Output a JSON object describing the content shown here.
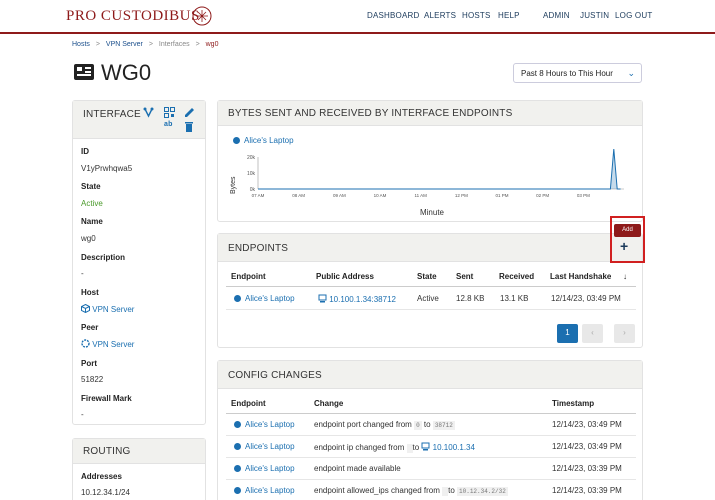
{
  "brand": "PRO CUSTODIBUS",
  "nav": [
    "DASHBOARD",
    "ALERTS",
    "HOSTS",
    "HELP",
    "ADMIN",
    "JUSTIN",
    "LOG OUT"
  ],
  "breadcrumb": [
    "Hosts",
    ">",
    "VPN Server",
    ">",
    "Interfaces",
    ">",
    "wg0"
  ],
  "page_title": "WG0",
  "time_range": "Past 8 Hours to This Hour",
  "interface_panel": {
    "title": "INTERFACE",
    "action_small": "ab",
    "fields": [
      {
        "label": "ID",
        "value": "V1yPrwhqwa5"
      },
      {
        "label": "State",
        "value": "Active"
      },
      {
        "label": "Name",
        "value": "wg0"
      },
      {
        "label": "Description",
        "value": "-"
      },
      {
        "label": "Host",
        "value": "VPN Server"
      },
      {
        "label": "Peer",
        "value": "VPN Server"
      },
      {
        "label": "Port",
        "value": "51822"
      },
      {
        "label": "Firewall Mark",
        "value": "-"
      }
    ]
  },
  "routing_panel": {
    "title": "ROUTING",
    "label": "Addresses",
    "value": "10.12.34.1/24"
  },
  "bytes_panel": {
    "title": "BYTES SENT AND RECEIVED BY INTERFACE ENDPOINTS",
    "legend": "Alice's Laptop"
  },
  "chart_data": {
    "type": "line",
    "title": "",
    "xlabel": "Minute",
    "ylabel": "Bytes",
    "yticks": [
      "20k",
      "10k",
      "0k"
    ],
    "ylim": [
      0,
      20000
    ],
    "categories": [
      "07 AM",
      "08 AM",
      "09 AM",
      "10 AM",
      "11 AM",
      "12 PM",
      "01 PM",
      "02 PM",
      "03 PM"
    ],
    "x": [
      "07 AM",
      "08 AM",
      "09 AM",
      "10 AM",
      "11 AM",
      "12 PM",
      "01 PM",
      "02 PM",
      "03 PM",
      "03:40 PM",
      "03:45 PM",
      "03:50 PM",
      "03:55 PM"
    ],
    "series": [
      {
        "name": "Alice's Laptop",
        "values": [
          0,
          0,
          0,
          0,
          0,
          0,
          0,
          0,
          0,
          0,
          25000,
          0,
          0
        ]
      }
    ],
    "grid": false,
    "legend_position": "top-left"
  },
  "endpoints_panel": {
    "title": "ENDPOINTS",
    "add_tooltip": "Add",
    "add_icon": "+",
    "columns": [
      "Endpoint",
      "Public Address",
      "State",
      "Sent",
      "Received",
      "Last Handshake"
    ],
    "sort_indicator": "↓",
    "rows": [
      {
        "endpoint": "Alice's Laptop",
        "address": "10.100.1.34:38712",
        "state": "Active",
        "sent": "12.8 KB",
        "received": "13.1 KB",
        "handshake": "12/14/23, 03:49 PM"
      }
    ],
    "pagination": {
      "page": "1",
      "prev": "‹",
      "next": "›"
    }
  },
  "config_panel": {
    "title": "CONFIG CHANGES",
    "columns": [
      "Endpoint",
      "Change",
      "Timestamp"
    ],
    "rows": [
      {
        "endpoint": "Alice's Laptop",
        "change": "endpoint port changed from",
        "from": "0",
        "to_label": "to",
        "to": "38712",
        "timestamp": "12/14/23, 03:49 PM"
      },
      {
        "endpoint": "Alice's Laptop",
        "change": "endpoint ip changed from",
        "from": "",
        "to_label": "to",
        "to": "10.100.1.34",
        "timestamp": "12/14/23, 03:49 PM"
      },
      {
        "endpoint": "Alice's Laptop",
        "change": "endpoint made available",
        "from": "",
        "to_label": "",
        "to": "",
        "timestamp": "12/14/23, 03:39 PM"
      },
      {
        "endpoint": "Alice's Laptop",
        "change": "endpoint allowed_ips changed from",
        "from": "",
        "to_label": "to",
        "to": "10.12.34.2/32",
        "timestamp": "12/14/23, 03:39 PM"
      }
    ]
  },
  "colors": {
    "brand": "#8e1a1a",
    "link": "#1b6fb0",
    "active": "#4a9a2a",
    "highlight": "#d12020"
  }
}
